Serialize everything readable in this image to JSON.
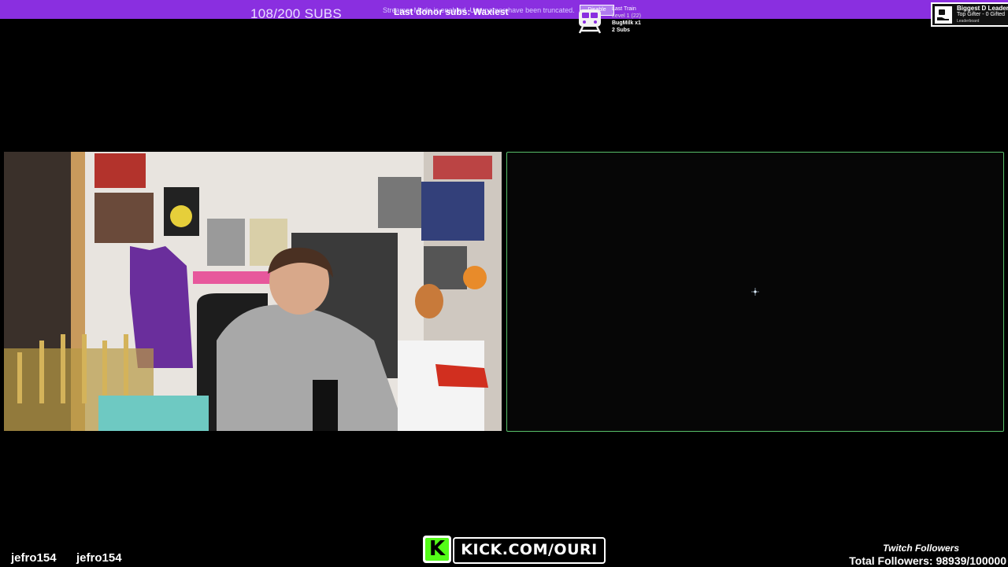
{
  "topbar": {
    "subs_goal": "108/200 SUBS",
    "truncation_notice": "Streamer Mode is enabled. Usernames have been truncated.",
    "last_donor": "Last donor subs: Waxiest",
    "toggle_label": "Disable",
    "accent_color": "#8a2fe0"
  },
  "train": {
    "icon": "train-icon",
    "title": "Last Train",
    "level": "Level 1 (22)",
    "user": "BugMilk x1",
    "subs": "2 Subs"
  },
  "leaderboard": {
    "icon": "hand-coin-icon",
    "title": "Biggest D Leaderboard",
    "subtitle": "Top Gifter - 0 Gifted",
    "caption": "Leaderboard"
  },
  "panels": {
    "webcam": "streamer-webcam",
    "screen_border_color": "#58c06a"
  },
  "chat": {
    "users": [
      "jefro154",
      "jefro154"
    ]
  },
  "kick": {
    "logo_letter": "K",
    "url": "KICK.COM/OURI",
    "brand_color": "#53fc18"
  },
  "followers": {
    "label": "Twitch Followers",
    "count_text": "Total Followers: 98939/100000"
  }
}
